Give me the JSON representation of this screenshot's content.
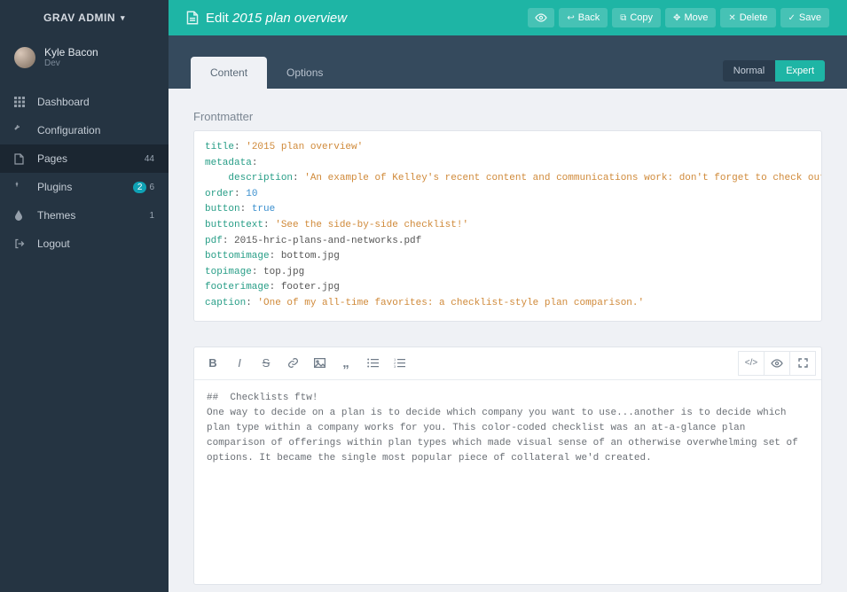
{
  "brand": "GRAV ADMIN",
  "user": {
    "name": "Kyle Bacon",
    "role": "Dev"
  },
  "nav": {
    "dashboard": "Dashboard",
    "configuration": "Configuration",
    "pages": "Pages",
    "pages_count": "44",
    "plugins": "Plugins",
    "plugins_pill": "2",
    "plugins_count": "6",
    "themes": "Themes",
    "themes_count": "1",
    "logout": "Logout"
  },
  "header": {
    "edit_label": "Edit",
    "page_title": "2015 plan overview",
    "actions": {
      "back": "Back",
      "copy": "Copy",
      "move": "Move",
      "delete": "Delete",
      "save": "Save"
    }
  },
  "tabs": {
    "content": "Content",
    "options": "Options"
  },
  "mode": {
    "normal": "Normal",
    "expert": "Expert"
  },
  "frontmatter": {
    "label": "Frontmatter",
    "kv": {
      "title_key": "title",
      "title_val": "'2015 plan overview'",
      "metadata_key": "metadata",
      "description_key": "description",
      "description_val": "'An example of Kelley's recent content and communications work: don't forget to check out the others in this",
      "order_key": "order",
      "order_val": "10",
      "button_key": "button",
      "button_val": "true",
      "buttontext_key": "buttontext",
      "buttontext_val": "'See the side-by-side checklist!'",
      "pdf_key": "pdf",
      "pdf_val": "2015-hric-plans-and-networks.pdf",
      "bottomimage_key": "bottomimage",
      "bottomimage_val": "bottom.jpg",
      "topimage_key": "topimage",
      "topimage_val": "top.jpg",
      "footerimage_key": "footerimage",
      "footerimage_val": "footer.jpg",
      "caption_key": "caption",
      "caption_val": "'One of my all-time favorites: a checklist-style plan comparison.'"
    }
  },
  "editor_body": "##  Checklists ftw!\nOne way to decide on a plan is to decide which company you want to use...another is to decide which plan type within a company works for you. This color-coded checklist was an at-a-glance plan comparison of offerings within plan types which made visual sense of an otherwise overwhelming set of options. It became the single most popular piece of collateral we'd created."
}
